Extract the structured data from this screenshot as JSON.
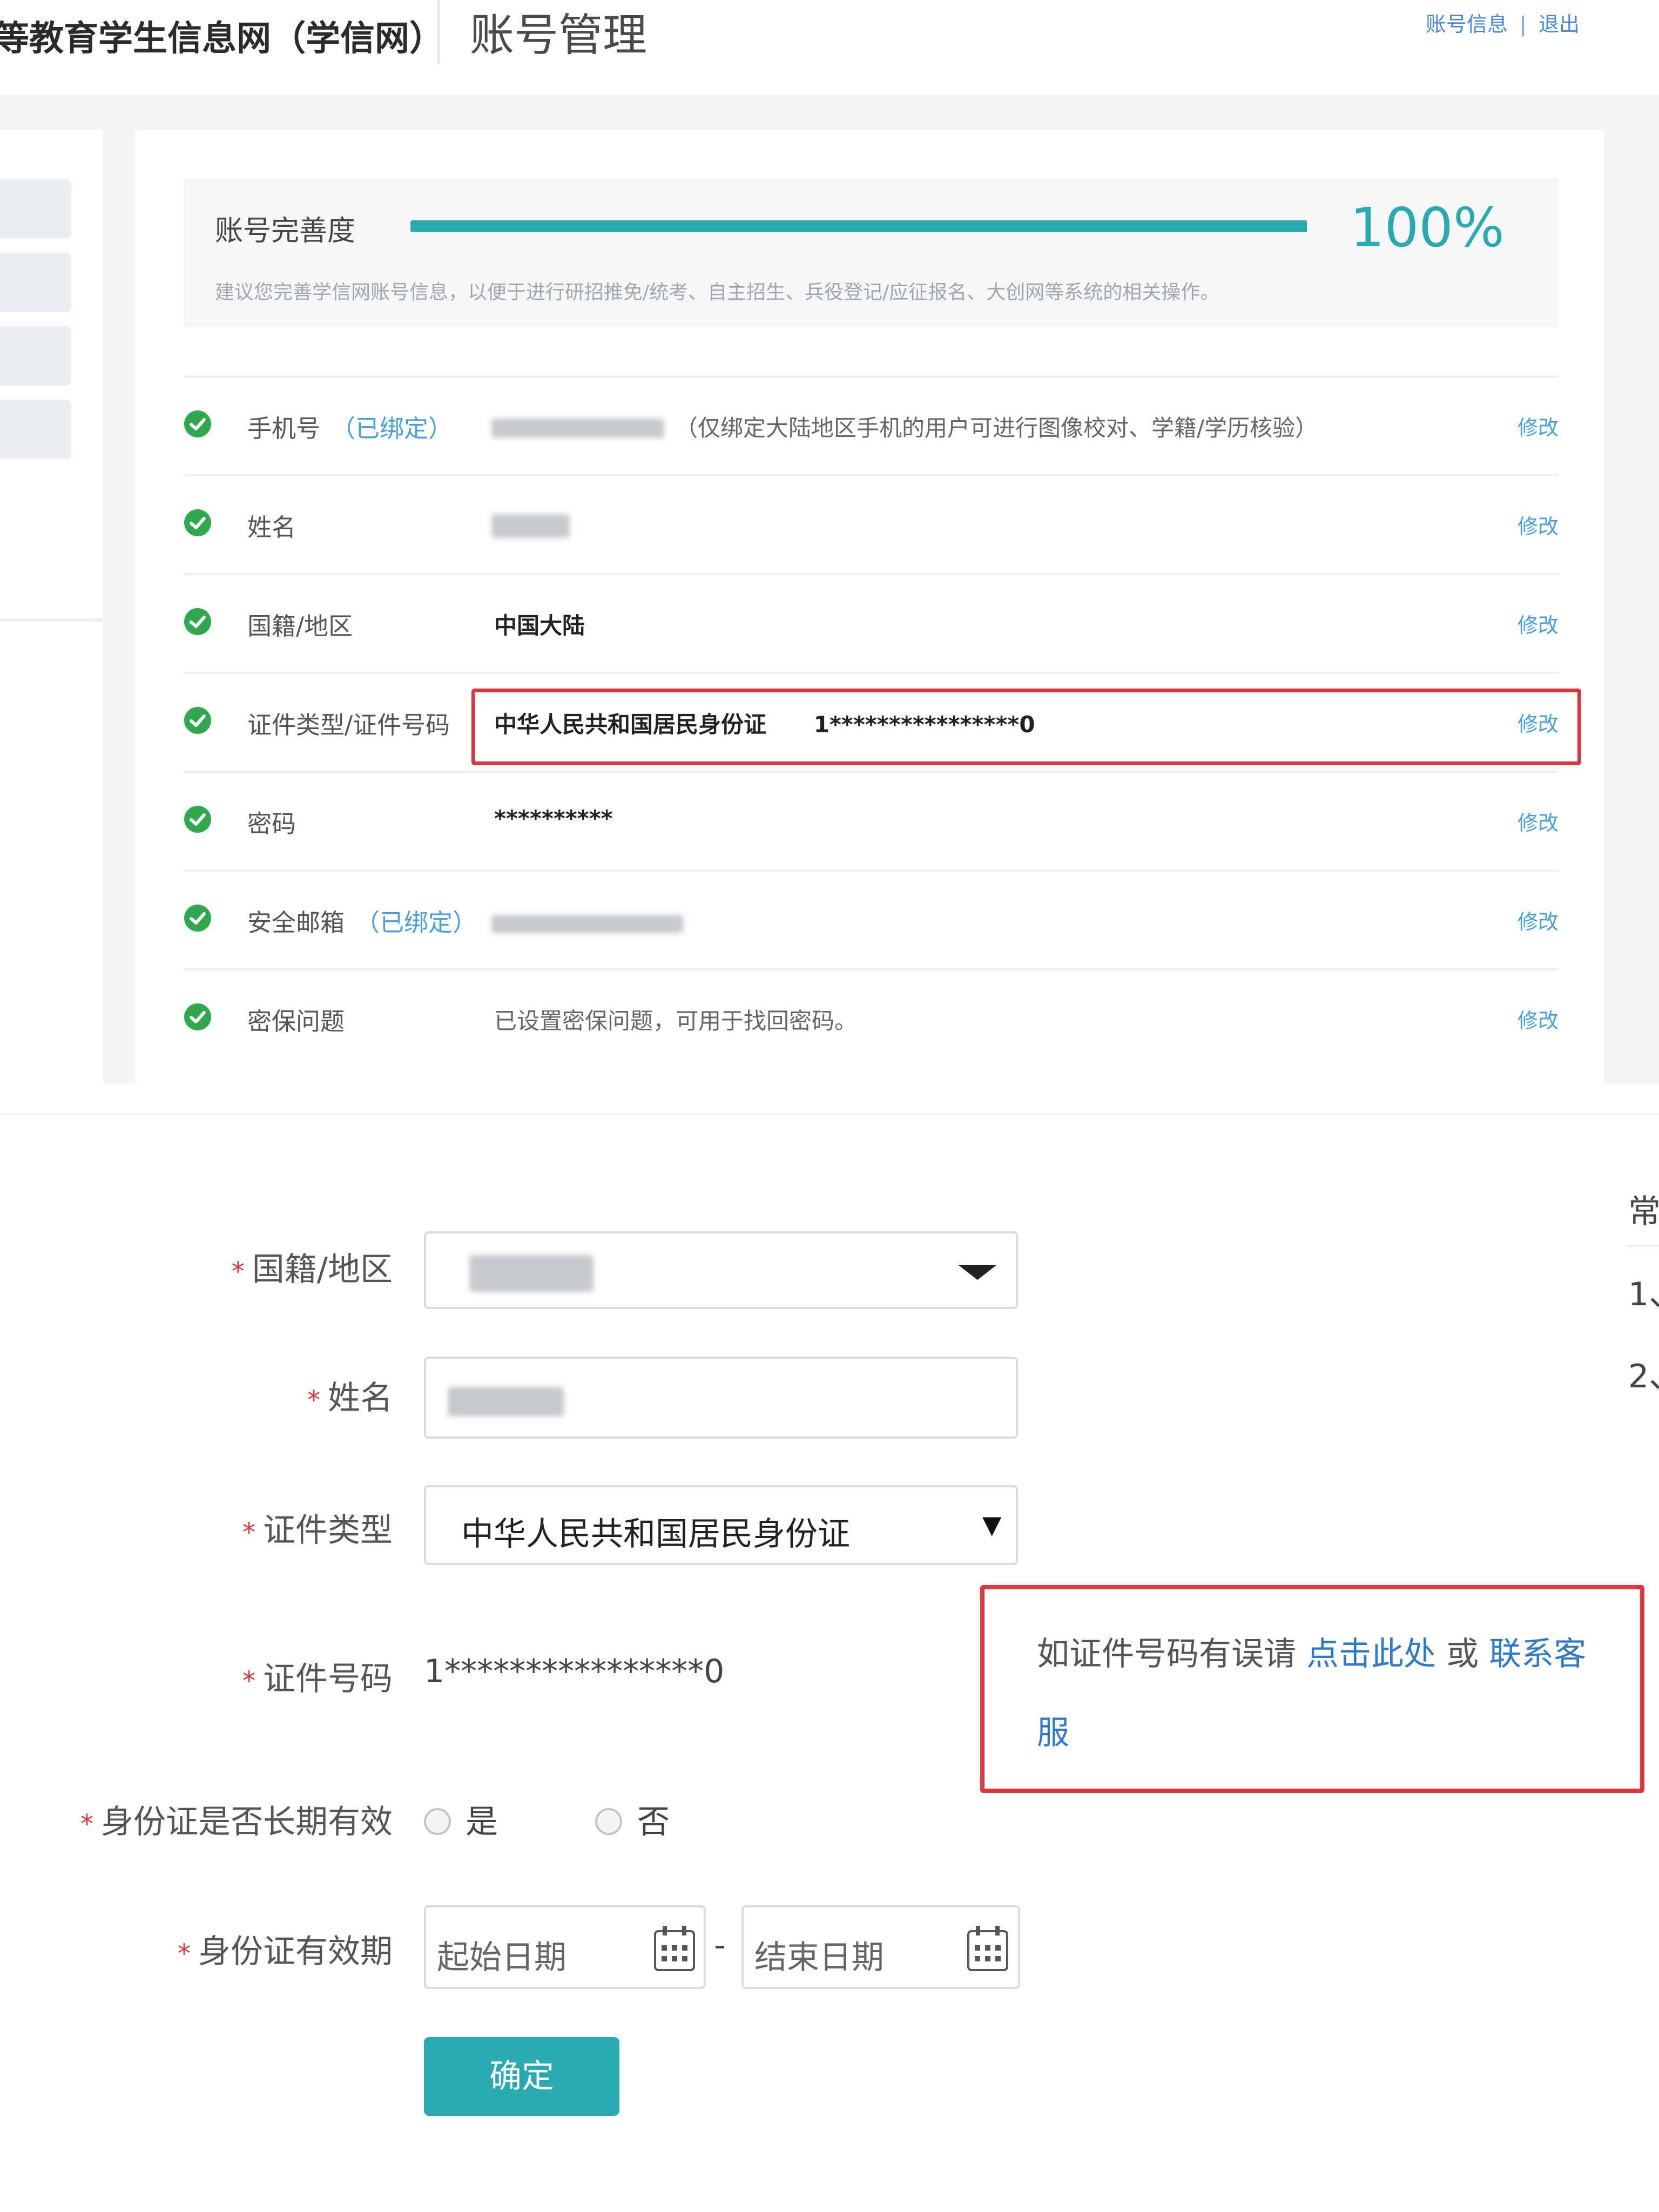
{
  "header": {
    "site_name": "等教育学生信息网（学信网）",
    "page_title": "账号管理",
    "links": [
      "账号信息",
      "退出"
    ],
    "link_separator": "|"
  },
  "completeness": {
    "label": "账号完善度",
    "percent_text": "100%",
    "progress": 1.0,
    "tip": "建议您完善学信网账号信息，以便于进行研招推免/统考、自主招生、兵役登记/应征报名、大创网等系统的相关操作。"
  },
  "info_rows": [
    {
      "label": "手机号",
      "bound": "（已绑定）",
      "value": "",
      "note": "（仅绑定大陆地区手机的用户可进行图像校对、学籍/学历核验）",
      "edit": "修改"
    },
    {
      "label": "姓名",
      "bound": "",
      "value": "",
      "note": "",
      "edit": "修改"
    },
    {
      "label": "国籍/地区",
      "bound": "",
      "value": "中国大陆",
      "note": "",
      "edit": "修改"
    },
    {
      "label": "证件类型/证件号码",
      "bound": "",
      "value": "中华人民共和国居民身份证      1****************0",
      "note": "",
      "edit": "修改"
    },
    {
      "label": "密码",
      "bound": "",
      "value": "**********",
      "note": "",
      "edit": "修改"
    },
    {
      "label": "安全邮箱",
      "bound": "（已绑定）",
      "value": "",
      "note": "",
      "edit": "修改"
    },
    {
      "label": "密保问题",
      "bound": "",
      "value": "已设置密保问题，可用于找回密码。",
      "note": "",
      "edit": "修改"
    }
  ],
  "form": {
    "required_mark": "*",
    "nationality": {
      "label": "国籍/地区",
      "value": ""
    },
    "name": {
      "label": "姓名",
      "value": ""
    },
    "id_type": {
      "label": "证件类型",
      "value": "中华人民共和国居民身份证"
    },
    "id_number": {
      "label": "证件号码",
      "value": "1****************0"
    },
    "long_term": {
      "label": "身份证是否长期有效",
      "options": [
        "是",
        "否"
      ],
      "selected": null
    },
    "validity": {
      "label": "身份证有效期",
      "start_placeholder": "起始日期",
      "end_placeholder": "结束日期",
      "separator": "-"
    },
    "confirm": "确定",
    "hint": {
      "prefix": "如证件号码有误请 ",
      "link1": "点击此处",
      "middle": " 或 ",
      "link2": "联系客服"
    }
  },
  "right_sidebar": {
    "heading": "常",
    "items": [
      "1、",
      "2、"
    ]
  },
  "colors": {
    "accent": "#2ba9b1",
    "link": "#4a9fd8",
    "highlight": "#d9363e",
    "check": "#2fa84f"
  },
  "icons": [
    "check-circle-icon",
    "dropdown-arrow-icon",
    "calendar-icon"
  ]
}
